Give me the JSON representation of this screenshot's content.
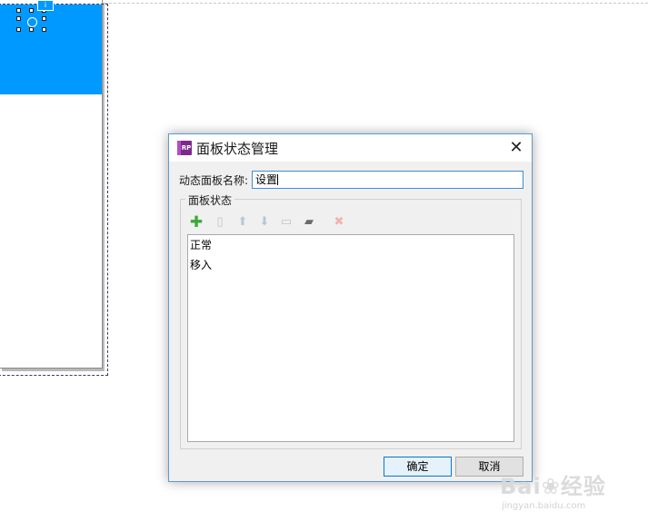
{
  "dialog": {
    "title": "面板状态管理",
    "app_icon_text": "RP",
    "close_glyph": "✕",
    "name_label": "动态面板名称:",
    "name_value": "设置",
    "group_label": "面板状态",
    "toolbar": [
      {
        "name": "add-state-icon",
        "glyph": "✚"
      },
      {
        "name": "copy-state-icon",
        "glyph": "▯"
      },
      {
        "name": "move-up-icon",
        "glyph": "⬆"
      },
      {
        "name": "move-down-icon",
        "glyph": "⬇"
      },
      {
        "name": "edit-state-icon",
        "glyph": "▭"
      },
      {
        "name": "edit-all-icon",
        "glyph": "▰"
      },
      {
        "name": "delete-state-icon",
        "glyph": "✖"
      }
    ],
    "states": [
      "正常",
      "移入"
    ],
    "ok_label": "确定",
    "cancel_label": "取消"
  },
  "canvas": {
    "info_tag": "i"
  },
  "watermark": {
    "brand": "Bai❀经验",
    "url": "jingyan.baidu.com"
  },
  "colors": {
    "accent": "#0099ff",
    "dialog_border": "#5b9bd5",
    "ok_border": "#0078d7"
  }
}
